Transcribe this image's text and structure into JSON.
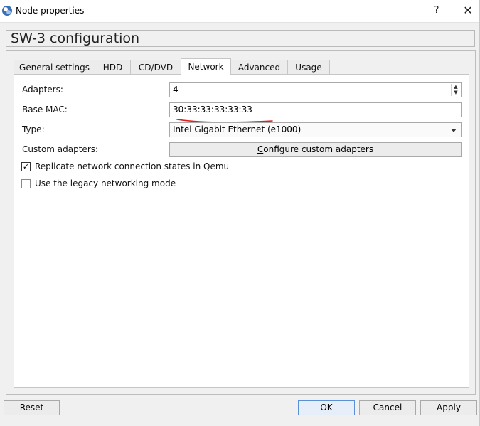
{
  "window": {
    "title": "Node properties",
    "help_label": "?",
    "close_label": "✕",
    "app_icon": "gns3-app-icon"
  },
  "config_title": "SW-3 configuration",
  "tabs": [
    {
      "label": "General settings",
      "active": false
    },
    {
      "label": "HDD",
      "active": false
    },
    {
      "label": "CD/DVD",
      "active": false
    },
    {
      "label": "Network",
      "active": true
    },
    {
      "label": "Advanced",
      "active": false
    },
    {
      "label": "Usage",
      "active": false
    }
  ],
  "network": {
    "adapters_label": "Adapters:",
    "adapters_value": "4",
    "base_mac_label": "Base MAC:",
    "base_mac_value": "30:33:33:33:33:33",
    "type_label": "Type:",
    "type_value": "Intel Gigabit Ethernet (e1000)",
    "custom_adapters_label": "Custom adapters:",
    "configure_button": {
      "mnemonic": "C",
      "rest": "onfigure custom adapters"
    },
    "replicate_label": "Replicate network connection states in Qemu",
    "replicate_checked": true,
    "legacy_label": "Use the legacy networking mode",
    "legacy_checked": false
  },
  "annotation": {
    "color": "#e02020"
  },
  "buttons": {
    "reset": "Reset",
    "ok": "OK",
    "cancel": "Cancel",
    "apply": "Apply"
  },
  "colors": {
    "default_button_border": "#5b8fd6",
    "window_bg": "#f0f0f0"
  }
}
